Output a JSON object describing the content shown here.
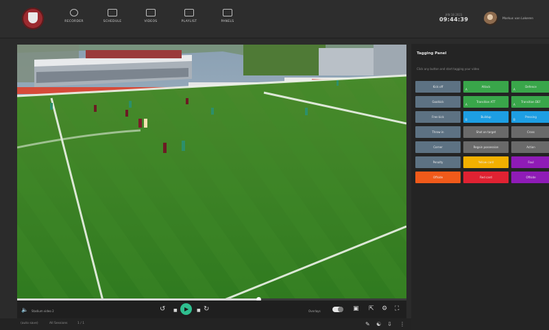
{
  "topbar": {
    "nav": [
      {
        "label": "RECORDER",
        "icon": "record-icon"
      },
      {
        "label": "SCHEDULE",
        "icon": "calendar-icon"
      },
      {
        "label": "VIDEOS",
        "icon": "video-icon"
      },
      {
        "label": "PLAYLIST",
        "icon": "playlist-icon"
      },
      {
        "label": "PANELS",
        "icon": "panels-icon"
      }
    ],
    "date": "JAN 18 2023",
    "time": "09:44:39",
    "user_name": "Markus van Lokeren"
  },
  "player": {
    "volume_label": "Stadium video 2",
    "playback_position": 0.62,
    "overlays_label": "Overlays",
    "overlays_on": true
  },
  "footer": {
    "left": "(auto save)",
    "middle": "All Sessions",
    "right": "1 / 1"
  },
  "panel": {
    "title": "Tagging Panel",
    "subtitle": "Click any button and start tagging your video",
    "buttons": [
      {
        "label": "Kick off",
        "color": "slate",
        "corner": ""
      },
      {
        "label": "Attack",
        "color": "green",
        "corner": "A"
      },
      {
        "label": "Defence",
        "color": "green",
        "corner": "A"
      },
      {
        "label": "Goalkick",
        "color": "slate",
        "corner": ""
      },
      {
        "label": "Transition ATT",
        "color": "green",
        "corner": "A"
      },
      {
        "label": "Transition DEF",
        "color": "green",
        "corner": "A"
      },
      {
        "label": "Free kick",
        "color": "slate",
        "corner": ""
      },
      {
        "label": "Buildup",
        "color": "blue",
        "corner": "B"
      },
      {
        "label": "Pressing",
        "color": "blue",
        "corner": "B"
      },
      {
        "label": "Throw in",
        "color": "slate",
        "corner": ""
      },
      {
        "label": "Shot on target",
        "color": "gray",
        "corner": ""
      },
      {
        "label": "Cross",
        "color": "gray",
        "corner": ""
      },
      {
        "label": "Corner",
        "color": "slate",
        "corner": ""
      },
      {
        "label": "Regain possession",
        "color": "gray",
        "corner": ""
      },
      {
        "label": "Action",
        "color": "gray",
        "corner": ""
      },
      {
        "label": "Penalty",
        "color": "slate",
        "corner": ""
      },
      {
        "label": "Yellow card",
        "color": "yellow",
        "corner": ""
      },
      {
        "label": "Foul",
        "color": "purple",
        "corner": ""
      },
      {
        "label": "Offside",
        "color": "orange",
        "corner": ""
      },
      {
        "label": "Red card",
        "color": "red",
        "corner": ""
      },
      {
        "label": "Offside",
        "color": "purple",
        "corner": ""
      }
    ]
  }
}
